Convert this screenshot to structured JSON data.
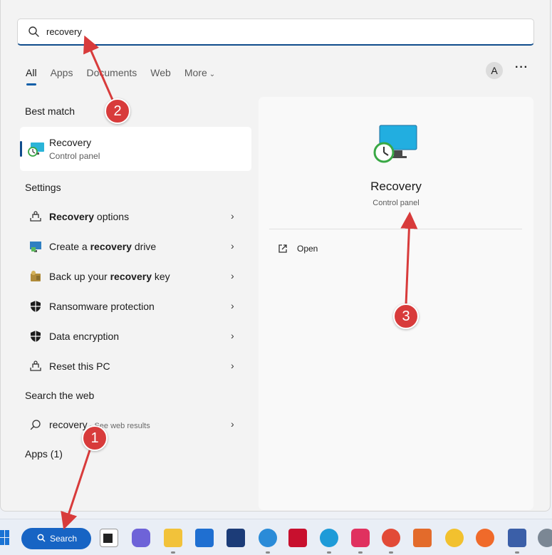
{
  "search": {
    "query": "recovery"
  },
  "filters": {
    "all": "All",
    "apps": "Apps",
    "documents": "Documents",
    "web": "Web",
    "more": "More"
  },
  "account": {
    "initial": "A",
    "more_dots": "···"
  },
  "best_match": {
    "heading": "Best match",
    "title": "Recovery",
    "subtitle": "Control panel"
  },
  "settings": {
    "heading": "Settings",
    "items": [
      {
        "pre": "",
        "bold": "Recovery",
        "post": " options"
      },
      {
        "pre": "Create a ",
        "bold": "recovery",
        "post": " drive"
      },
      {
        "pre": "Back up your ",
        "bold": "recovery",
        "post": " key"
      },
      {
        "pre": "Ransomware protection",
        "bold": "",
        "post": ""
      },
      {
        "pre": "Data encryption",
        "bold": "",
        "post": ""
      },
      {
        "pre": "Reset this PC",
        "bold": "",
        "post": ""
      }
    ]
  },
  "web": {
    "heading": "Search the web",
    "query": "recovery",
    "suffix": " - See web results"
  },
  "apps": {
    "heading": "Apps (1)"
  },
  "detail": {
    "title": "Recovery",
    "subtitle": "Control panel",
    "open_label": "Open"
  },
  "annotations": {
    "one": "1",
    "two": "2",
    "three": "3"
  },
  "taskbar": {
    "search_label": "Search"
  },
  "colors": {
    "accent": "#0f4c8c",
    "annotation_red": "#d83b3b",
    "taskbar_search": "#1764c4"
  }
}
